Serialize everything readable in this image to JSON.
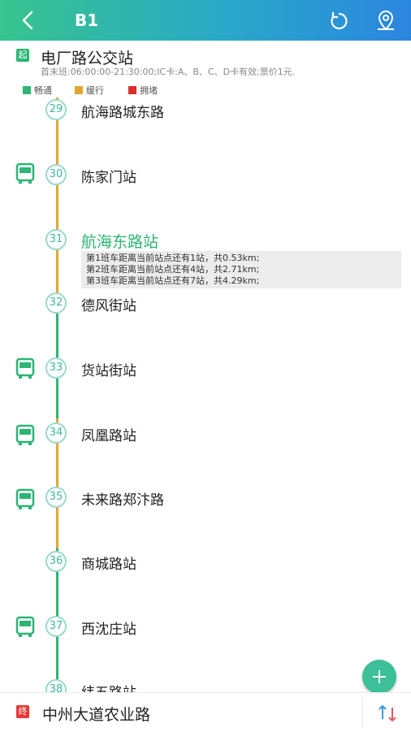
{
  "header": {
    "title": "B1",
    "back_icon": "back-arrow-icon",
    "refresh_icon": "refresh-icon",
    "location_icon": "map-pin-icon",
    "gradient": [
      "#37c48d",
      "#2b86e0"
    ]
  },
  "start": {
    "badge": "起",
    "name": "电厂路公交站",
    "info": "首末班:06:00:00-21:30:00;IC卡:A、B、C、D卡有效;票价1元."
  },
  "legend": [
    {
      "label": "畅通",
      "color": "#2bb673"
    },
    {
      "label": "缓行",
      "color": "#e0a82e"
    },
    {
      "label": "拥堵",
      "color": "#d9302c"
    }
  ],
  "stops": [
    {
      "num": "29",
      "name": "航海路城东路"
    },
    {
      "num": "30",
      "name": "陈家门站"
    },
    {
      "num": "31",
      "name": "航海东路站"
    },
    {
      "num": "32",
      "name": "德风街站"
    },
    {
      "num": "33",
      "name": "货站街站"
    },
    {
      "num": "34",
      "name": "凤凰路站"
    },
    {
      "num": "35",
      "name": "未来路郑汴路"
    },
    {
      "num": "36",
      "name": "商城路站"
    },
    {
      "num": "37",
      "name": "西沈庄站"
    },
    {
      "num": "38",
      "name": "纬五路站"
    }
  ],
  "eta": [
    "第1班车距离当前站点还有1站，共0.53km;",
    "第2班车距离当前站点还有4站，共2.71km;",
    "第3班车距离当前站点还有7站，共4.29km;"
  ],
  "end": {
    "badge": "终",
    "name": "中州大道农业路",
    "swap_icon": "swap-icon"
  },
  "fab_icon": "plus-icon"
}
